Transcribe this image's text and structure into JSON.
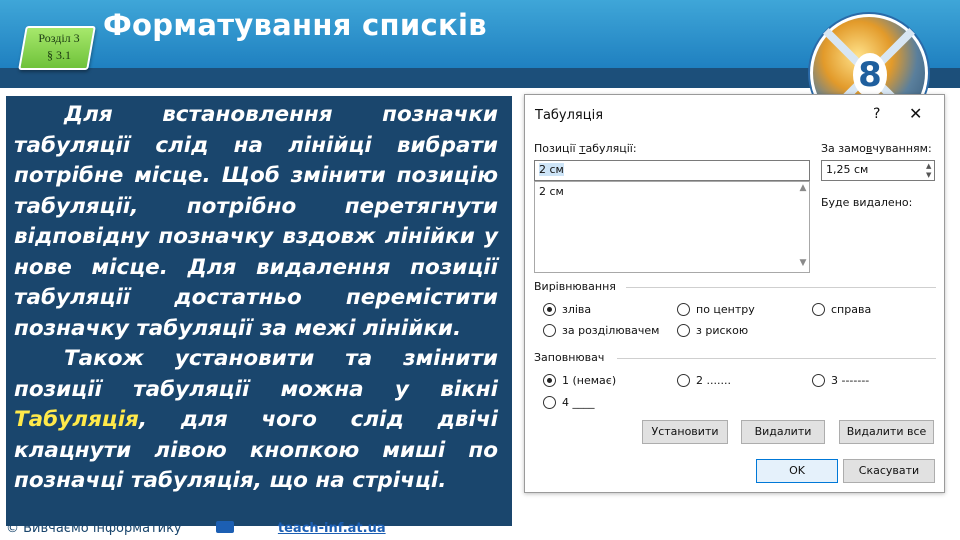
{
  "slide": {
    "section": "Розділ 3",
    "paragraph": "§ 3.1",
    "title": "Форматування списків",
    "logo_number": "8"
  },
  "text": {
    "p1": "Для встановлення позначки табуляції слід на лінійці вибрати потрібне місце. Щоб змінити позицію табуляції, потрібно перетягнути відповідну позначку вздовж лінійки у нове місце. Для видалення позиції табуляції достатньо перемістити позначку табуляції за межі лінійки.",
    "p2_before": "Також установити та змінити позиції табуляції можна у вікні ",
    "p2_highlight": "Табуляція",
    "p2_after": ", для чого слід двічі клацнути лівою кнопкою миші по позначці табуляція, що на стрічці."
  },
  "footer": {
    "copyright": "© Вивчаємо інформатику",
    "site": "teach-inf.at.ua"
  },
  "dialog": {
    "title": "Табуляція",
    "help": "?",
    "close": "✕",
    "tab_positions_label_pre": "Позиції ",
    "tab_positions_label_u": "т",
    "tab_positions_label_post": "абуляції:",
    "tab_position_value": "2 см",
    "tab_list": [
      "2 см"
    ],
    "default_label_pre": "За замо",
    "default_label_u": "в",
    "default_label_post": "чуванням:",
    "default_value": "1,25 см",
    "to_clear_label": "Буде видалено:",
    "alignment_title": "Вирівнювання",
    "alignment": {
      "left": "зліва",
      "center": "по центру",
      "right": "справа",
      "decimal": "за розділювачем",
      "bar": "з рискою",
      "selected": "left"
    },
    "leader_title": "Заповнювач",
    "leader": {
      "opt1": "1 (немає)",
      "opt2": "2 .......",
      "opt3": "3 -------",
      "opt4": "4 ____",
      "selected": "1"
    },
    "buttons": {
      "set": "Установити",
      "clear": "Видалити",
      "clear_all": "Видалити все",
      "ok": "OK",
      "cancel": "Скасувати"
    }
  },
  "colors": {
    "header": "#1f80c0",
    "panel": "#1a466d",
    "highlight": "#ffe94a",
    "section_box": "#6fc23a"
  }
}
